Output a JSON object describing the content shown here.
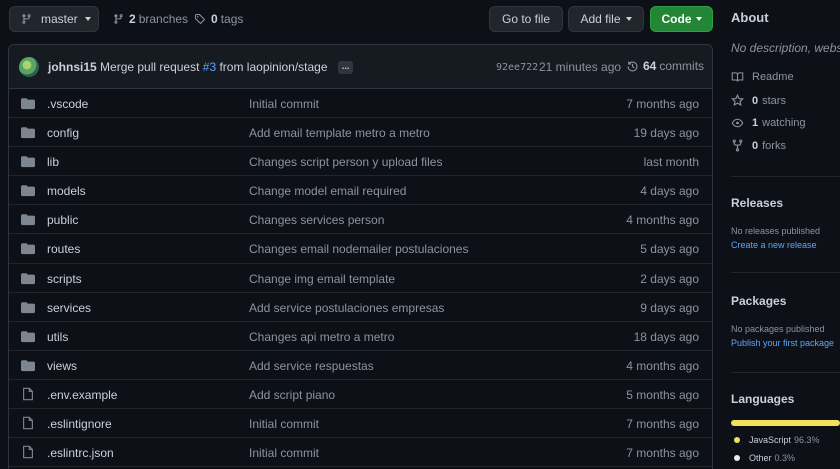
{
  "toolbar": {
    "branch": "master",
    "branches_count": "2",
    "branches_label": "branches",
    "tags_count": "0",
    "tags_label": "tags",
    "go_to_file": "Go to file",
    "add_file": "Add file",
    "code": "Code"
  },
  "commit": {
    "author": "johnsi15",
    "message_prefix": "Merge pull request",
    "pr": "#3",
    "message_suffix": "from laopinion/stage",
    "dots": "...",
    "sha": "92ee722",
    "time": "21 minutes ago",
    "count": "64",
    "count_label": "commits"
  },
  "files": [
    {
      "type": "folder",
      "name": ".vscode",
      "message": "Initial commit",
      "age": "7 months ago"
    },
    {
      "type": "folder",
      "name": "config",
      "message": "Add email template metro a metro",
      "age": "19 days ago"
    },
    {
      "type": "folder",
      "name": "lib",
      "message": "Changes script person y upload files",
      "age": "last month"
    },
    {
      "type": "folder",
      "name": "models",
      "message": "Change model email required",
      "age": "4 days ago"
    },
    {
      "type": "folder",
      "name": "public",
      "message": "Changes services person",
      "age": "4 months ago"
    },
    {
      "type": "folder",
      "name": "routes",
      "message": "Changes email nodemailer postulaciones",
      "age": "5 days ago"
    },
    {
      "type": "folder",
      "name": "scripts",
      "message": "Change img email template",
      "age": "2 days ago"
    },
    {
      "type": "folder",
      "name": "services",
      "message": "Add service postulaciones empresas",
      "age": "9 days ago"
    },
    {
      "type": "folder",
      "name": "utils",
      "message": "Changes api metro a metro",
      "age": "18 days ago"
    },
    {
      "type": "folder",
      "name": "views",
      "message": "Add service respuestas",
      "age": "4 months ago"
    },
    {
      "type": "file",
      "name": ".env.example",
      "message": "Add script piano",
      "age": "5 months ago"
    },
    {
      "type": "file",
      "name": ".eslintignore",
      "message": "Initial commit",
      "age": "7 months ago"
    },
    {
      "type": "file",
      "name": ".eslintrc.json",
      "message": "Initial commit",
      "age": "7 months ago"
    }
  ],
  "sidebar": {
    "about_title": "About",
    "description": "No description, webs",
    "readme": "Readme",
    "stars_count": "0",
    "stars_label": "stars",
    "watching_count": "1",
    "watching_label": "watching",
    "forks_count": "0",
    "forks_label": "forks",
    "releases_title": "Releases",
    "no_releases": "No releases published",
    "create_release": "Create a new release",
    "packages_title": "Packages",
    "no_packages": "No packages published",
    "publish_package": "Publish your first package",
    "languages_title": "Languages",
    "languages": [
      {
        "name": "JavaScript",
        "percent": "96.3%",
        "color": "#f1e05a"
      },
      {
        "name": "Other",
        "percent": "0.3%",
        "color": "#ededed"
      }
    ]
  }
}
